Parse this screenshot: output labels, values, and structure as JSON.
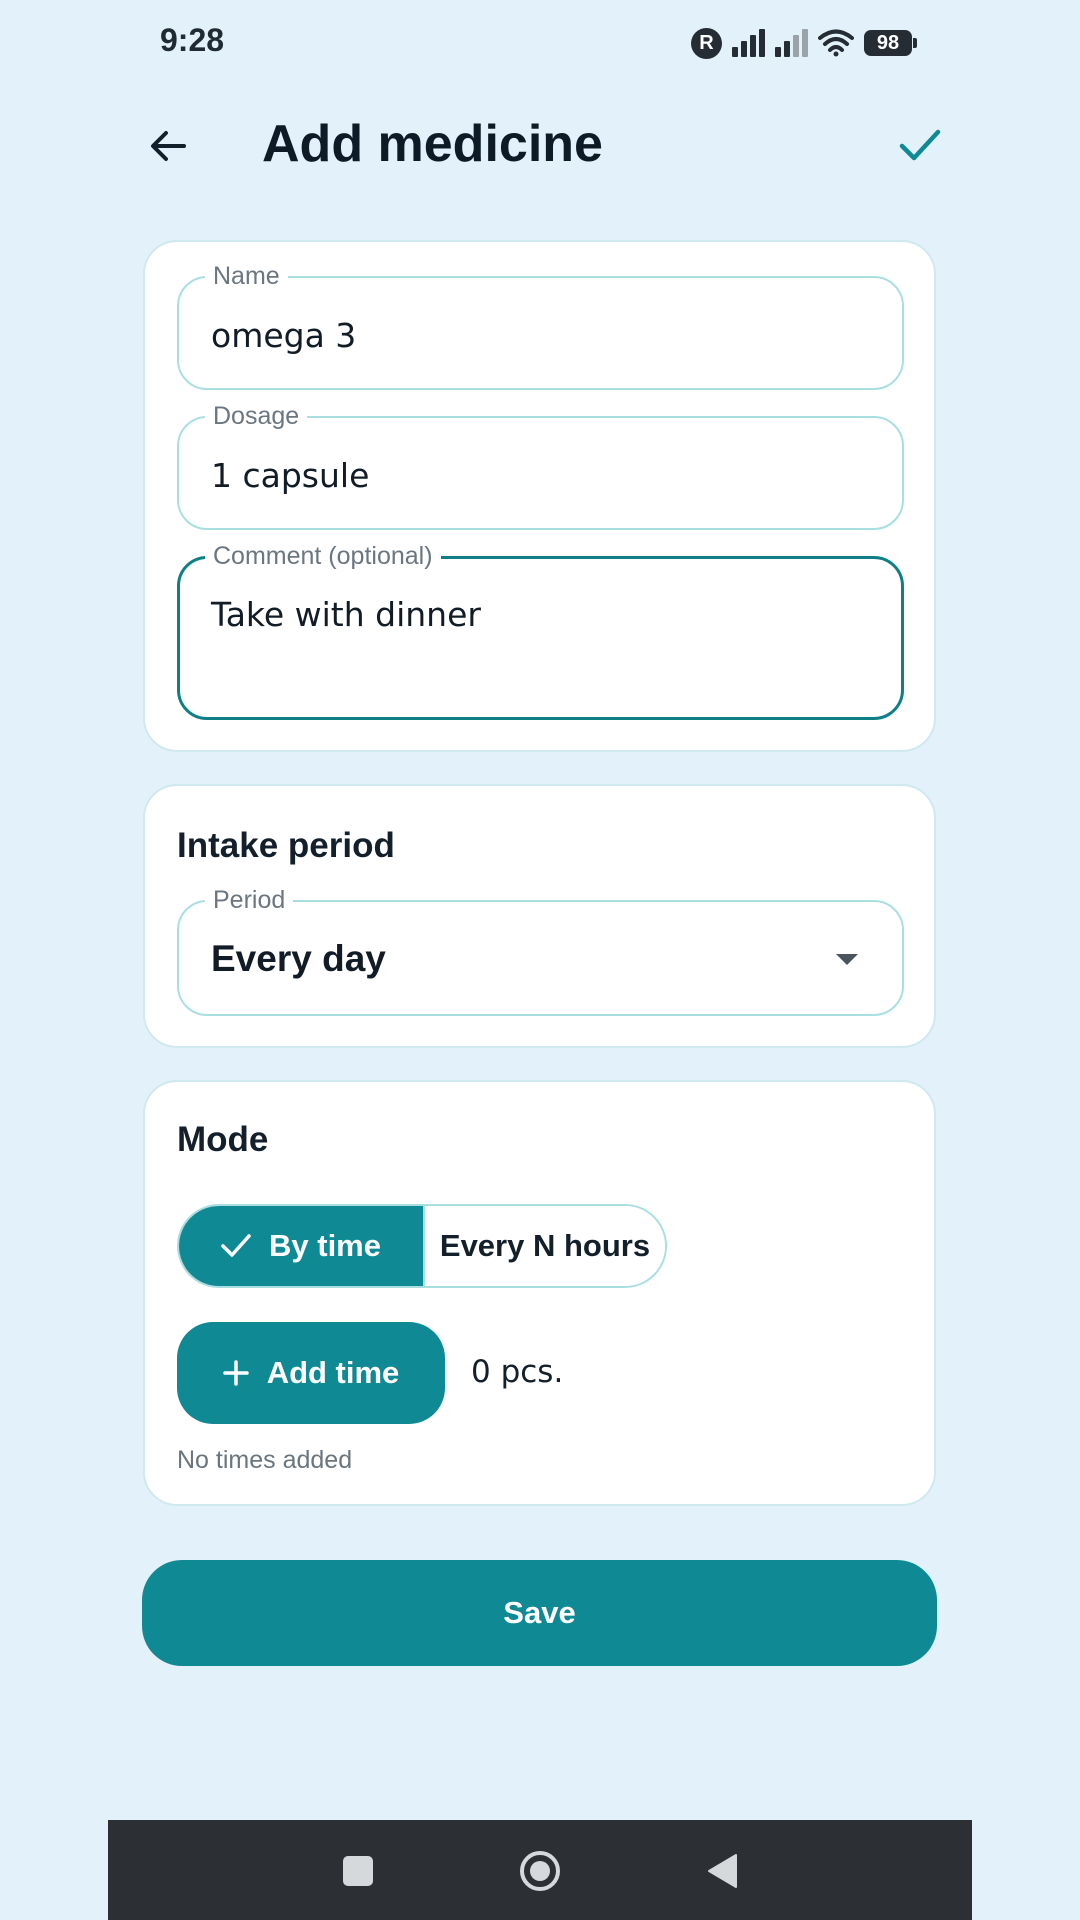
{
  "status_bar": {
    "time": "9:28",
    "badge": "R",
    "battery": "98"
  },
  "header": {
    "title": "Add medicine",
    "back_icon": "arrow-left-icon",
    "confirm_icon": "check-icon"
  },
  "form": {
    "name": {
      "label": "Name",
      "value": "omega 3"
    },
    "dosage": {
      "label": "Dosage",
      "value": "1 capsule"
    },
    "comment": {
      "label": "Comment (optional)",
      "value": "Take with dinner"
    }
  },
  "intake_period": {
    "title": "Intake period",
    "period": {
      "label": "Period",
      "value": "Every day"
    }
  },
  "mode": {
    "title": "Mode",
    "options": [
      {
        "label": "By time",
        "selected": true
      },
      {
        "label": "Every N hours",
        "selected": false
      }
    ],
    "add_time_label": "Add time",
    "count": "0 pcs.",
    "empty_note": "No times added"
  },
  "actions": {
    "save_label": "Save"
  },
  "colors": {
    "background": "#e3f1fb",
    "accent": "#0f8a95",
    "field_border": "#a9dfe0",
    "focused_border": "#0f7f86"
  }
}
